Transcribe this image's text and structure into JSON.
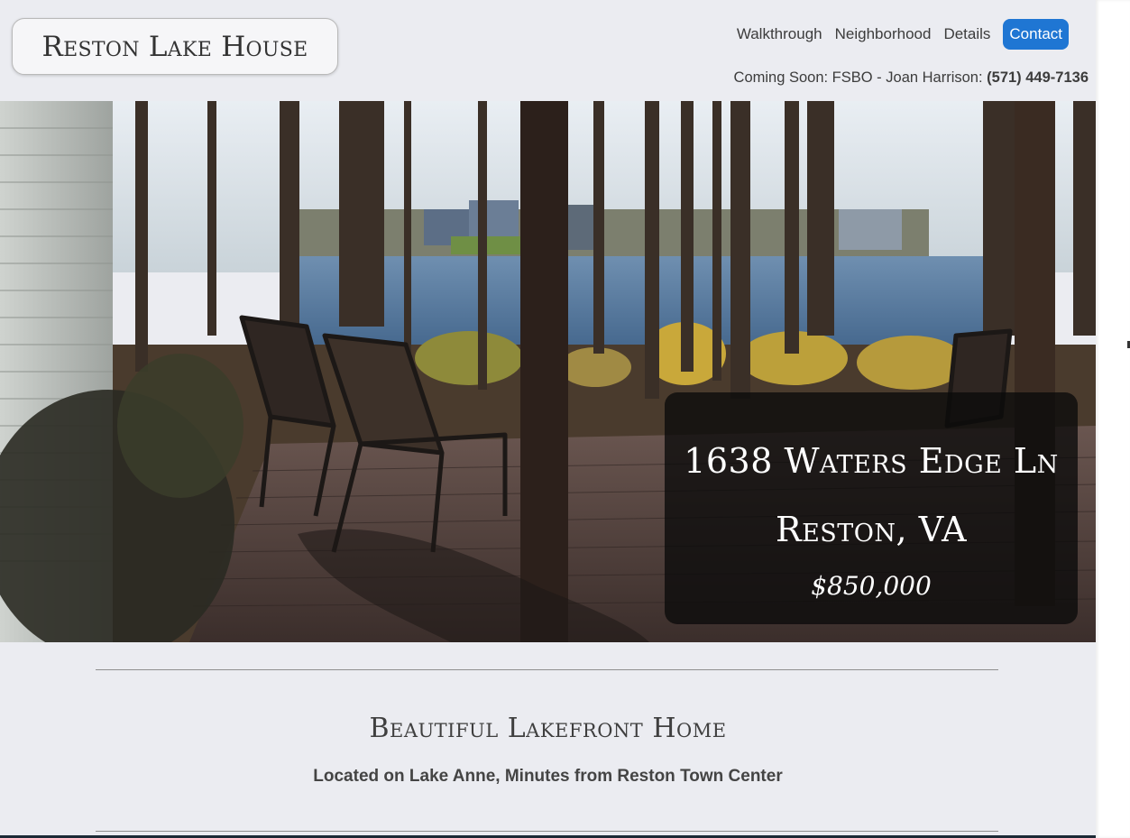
{
  "header": {
    "logo_text": "Reston Lake House",
    "nav": [
      {
        "label": "Walkthrough"
      },
      {
        "label": "Neighborhood"
      },
      {
        "label": "Details"
      },
      {
        "label": "Contact"
      }
    ],
    "coming_soon_text": "Coming Soon: FSBO - Joan Harrison: ",
    "phone": "(571) 449-7136"
  },
  "hero": {
    "address_line1": "1638 Waters Edge Ln",
    "address_line2": "Reston, VA",
    "price": "$850,000"
  },
  "main": {
    "title": "Beautiful Lakefront Home",
    "subtitle": "Located on Lake Anne, Minutes from Reston Town Center"
  },
  "colors": {
    "page_background": "#ebecf1",
    "contact_button": "#1f76d3",
    "text": "#3c3c3c"
  }
}
